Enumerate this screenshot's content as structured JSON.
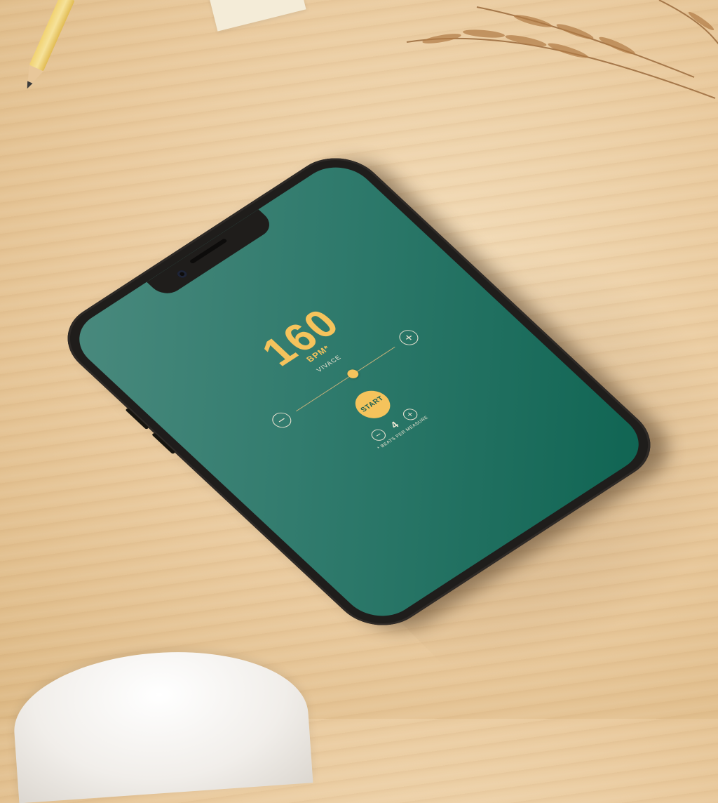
{
  "metronome": {
    "bpm": "160",
    "bpm_unit": "BPM*",
    "tempo_name": "VIVACE",
    "tempo_level": 0.58,
    "start_label": "START",
    "decrease_bpm": "−",
    "increase_bpm": "+",
    "beats_per_measure": "4",
    "beats_decrease": "−",
    "beats_increase": "+",
    "beats_label": "* BEATS PER MEASURE"
  },
  "colors": {
    "accent": "#f5c35c",
    "screen_background": "#2f7a6c",
    "frame": "#1f1d1b"
  }
}
